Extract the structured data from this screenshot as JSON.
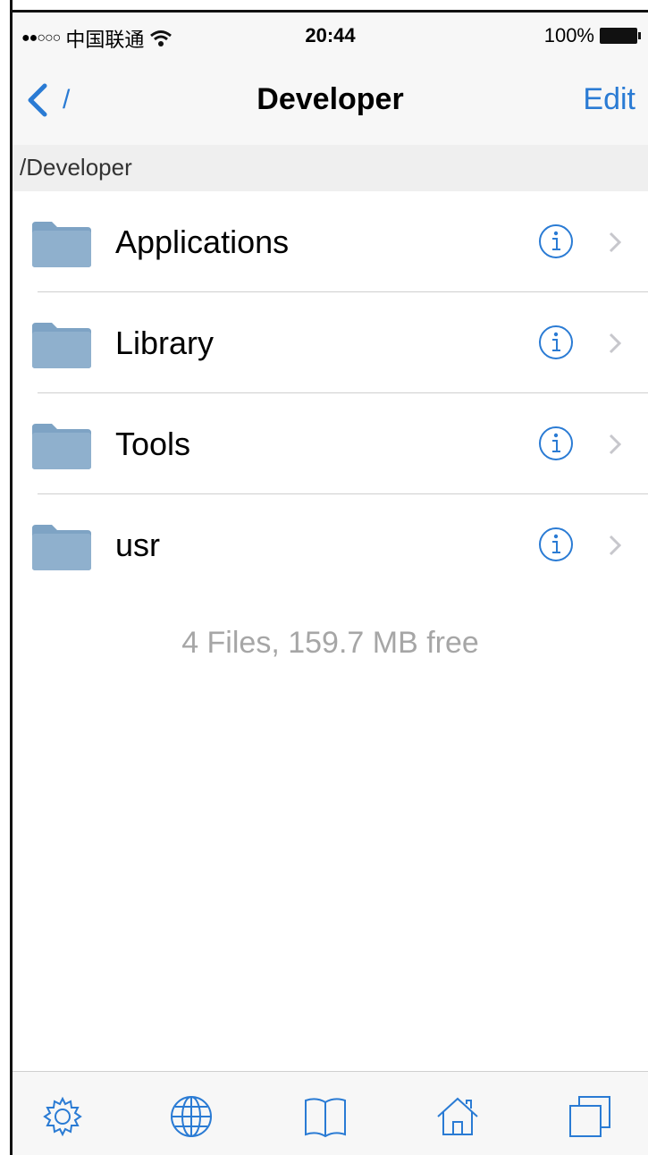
{
  "status_bar": {
    "signal": "●●○○○",
    "carrier": "中国联通",
    "time": "20:44",
    "battery": "100%"
  },
  "nav_bar": {
    "back_label": "/",
    "title": "Developer",
    "edit_label": "Edit"
  },
  "path": "/Developer",
  "files": [
    {
      "name": "Applications"
    },
    {
      "name": "Library"
    },
    {
      "name": "Tools"
    },
    {
      "name": "usr"
    }
  ],
  "footer": "4 Files, 159.7 MB free",
  "colors": {
    "accent": "#2a7bd4",
    "folder": "#7ea3c4",
    "secondary_text": "#a6a6a6"
  },
  "tab_bar": [
    {
      "icon": "gear-icon"
    },
    {
      "icon": "globe-icon"
    },
    {
      "icon": "book-icon"
    },
    {
      "icon": "home-icon"
    },
    {
      "icon": "windows-icon"
    }
  ]
}
